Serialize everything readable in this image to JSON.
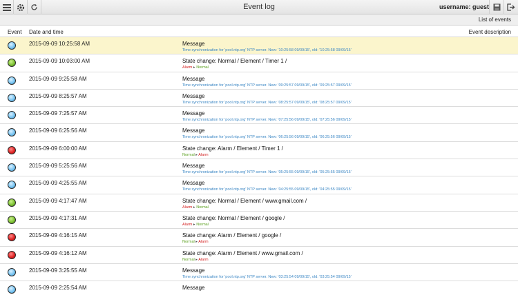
{
  "header": {
    "title": "Event log",
    "username": "username: guest"
  },
  "subheader": {
    "list_label": "List of events"
  },
  "columns": {
    "event": "Event",
    "datetime": "Date and time",
    "description": "Event description"
  },
  "colors": {
    "blue": "#79c5f2",
    "green": "#7ec234",
    "red": "#e02424",
    "highlight": "#fbf5cc"
  },
  "events": [
    {
      "status": "blue",
      "time": "2015-09-09 10:25:58 AM",
      "title": "Message",
      "detail": "Time synchronization for 'pool.ntp.org' NTP server. New: '10:25:58 09/09/15', old: '10:25:58 09/09/15'"
    },
    {
      "status": "green",
      "time": "2015-09-09 10:03:00 AM",
      "title": "State change: Normal / Element / Timer 1 /",
      "from": "Alarm",
      "to": "Normal"
    },
    {
      "status": "blue",
      "time": "2015-09-09 9:25:58 AM",
      "title": "Message",
      "detail": "Time synchronization for 'pool.ntp.org' NTP server. New: '09:25:57 09/09/15', old: '09:25:57 09/09/15'"
    },
    {
      "status": "blue",
      "time": "2015-09-09 8:25:57 AM",
      "title": "Message",
      "detail": "Time synchronization for 'pool.ntp.org' NTP server. New: '08:25:57 09/09/15', old: '08:25:57 09/09/15'"
    },
    {
      "status": "blue",
      "time": "2015-09-09 7:25:57 AM",
      "title": "Message",
      "detail": "Time synchronization for 'pool.ntp.org' NTP server. New: '07:25:56 09/09/15', old: '07:25:56 09/09/15'"
    },
    {
      "status": "blue",
      "time": "2015-09-09 6:25:56 AM",
      "title": "Message",
      "detail": "Time synchronization for 'pool.ntp.org' NTP server. New: '06:25:56 09/09/15', old: '06:25:56 09/09/15'"
    },
    {
      "status": "red",
      "time": "2015-09-09 6:00:00 AM",
      "title": "State change: Alarm / Element / Timer 1 /",
      "from": "Normal",
      "to": "Alarm"
    },
    {
      "status": "blue",
      "time": "2015-09-09 5:25:56 AM",
      "title": "Message",
      "detail": "Time synchronization for 'pool.ntp.org' NTP server. New: '05:25:55 09/09/15', old: '05:25:55 09/09/15'"
    },
    {
      "status": "blue",
      "time": "2015-09-09 4:25:55 AM",
      "title": "Message",
      "detail": "Time synchronization for 'pool.ntp.org' NTP server. New: '04:25:55 09/09/15', old: '04:25:55 09/09/15'"
    },
    {
      "status": "green",
      "time": "2015-09-09 4:17:47 AM",
      "title": "State change: Normal / Element / www.gmail.com /",
      "from": "Alarm",
      "to": "Normal"
    },
    {
      "status": "green",
      "time": "2015-09-09 4:17:31 AM",
      "title": "State change: Normal / Element / google /",
      "from": "Alarm",
      "to": "Normal"
    },
    {
      "status": "red",
      "time": "2015-09-09 4:16:15 AM",
      "title": "State change: Alarm / Element / google /",
      "from": "Normal",
      "to": "Alarm"
    },
    {
      "status": "red",
      "time": "2015-09-09 4:16:12 AM",
      "title": "State change: Alarm / Element / www.gmail.com /",
      "from": "Normal",
      "to": "Alarm"
    },
    {
      "status": "blue",
      "time": "2015-09-09 3:25:55 AM",
      "title": "Message",
      "detail": "Time synchronization for 'pool.ntp.org' NTP server. New: '03:25:54 09/09/15', old: '03:25:54 09/09/15'"
    },
    {
      "status": "blue",
      "time": "2015-09-09 2:25:54 AM",
      "title": "Message",
      "detail": ""
    }
  ],
  "icons": {
    "menu": "menu-icon",
    "settings": "gear-icon",
    "refresh": "refresh-icon",
    "save": "save-icon",
    "logout": "logout-icon"
  }
}
